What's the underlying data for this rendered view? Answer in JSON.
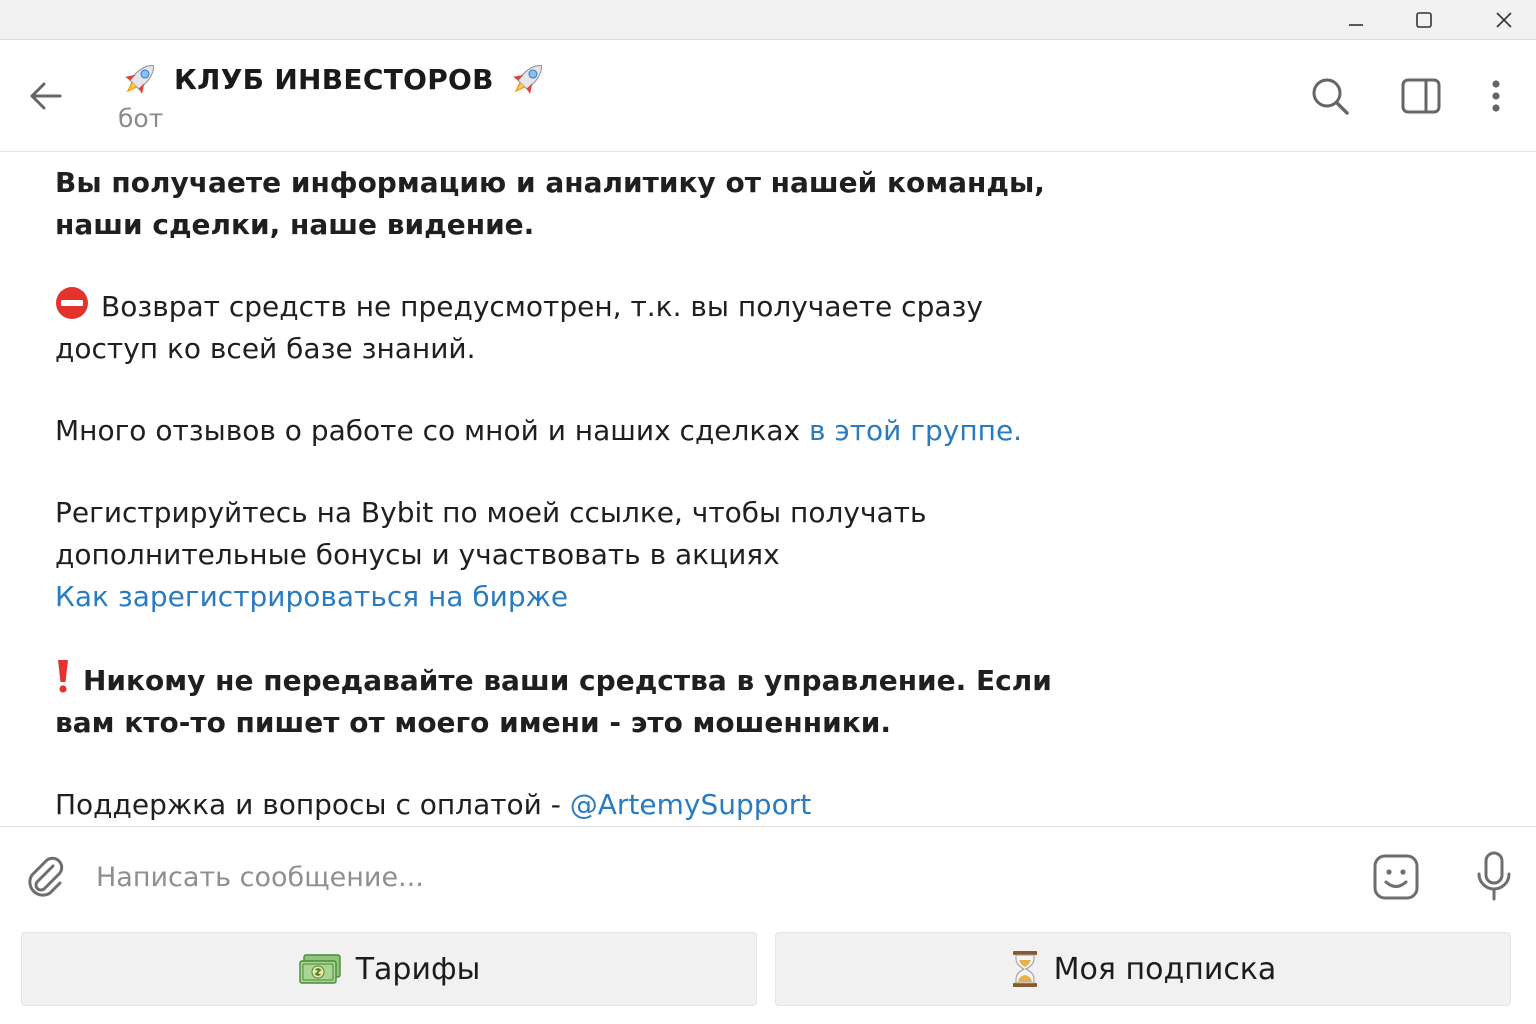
{
  "header": {
    "title": "КЛУБ ИНВЕСТОРОВ",
    "subtitle": "бот",
    "title_icon": "rocket-icon"
  },
  "message": {
    "p1": "Вы получаете информацию и аналитику от нашей команды, наши сделки, наше видение.",
    "p2": "Возврат средств не предусмотрен, т.к. вы получаете сразу доступ ко всей базе знаний.",
    "p3_text": "Много отзывов о работе со мной и наших сделках ",
    "p3_link": "в этой группе.",
    "p4_text": "Регистрируйтесь на Bybit по моей ссылке, чтобы получать дополнительные бонусы и участвовать в акциях",
    "p4_link": "Как зарегистрироваться на бирже",
    "p5": "Никому не передавайте ваши средства в управление. Если вам кто-то пишет от моего имени - это мошенники.",
    "p6_text": "Поддержка и вопросы с оплатой - ",
    "p6_link": "@ArtemySupport"
  },
  "composer": {
    "placeholder": "Написать сообщение..."
  },
  "keyboard": {
    "tariffs": "Тарифы",
    "subscription": "Моя подписка"
  },
  "colors": {
    "link": "#2a7bbf",
    "text": "#1f1f1f",
    "muted": "#8a8a8a",
    "button_bg": "#f1f1f1"
  }
}
